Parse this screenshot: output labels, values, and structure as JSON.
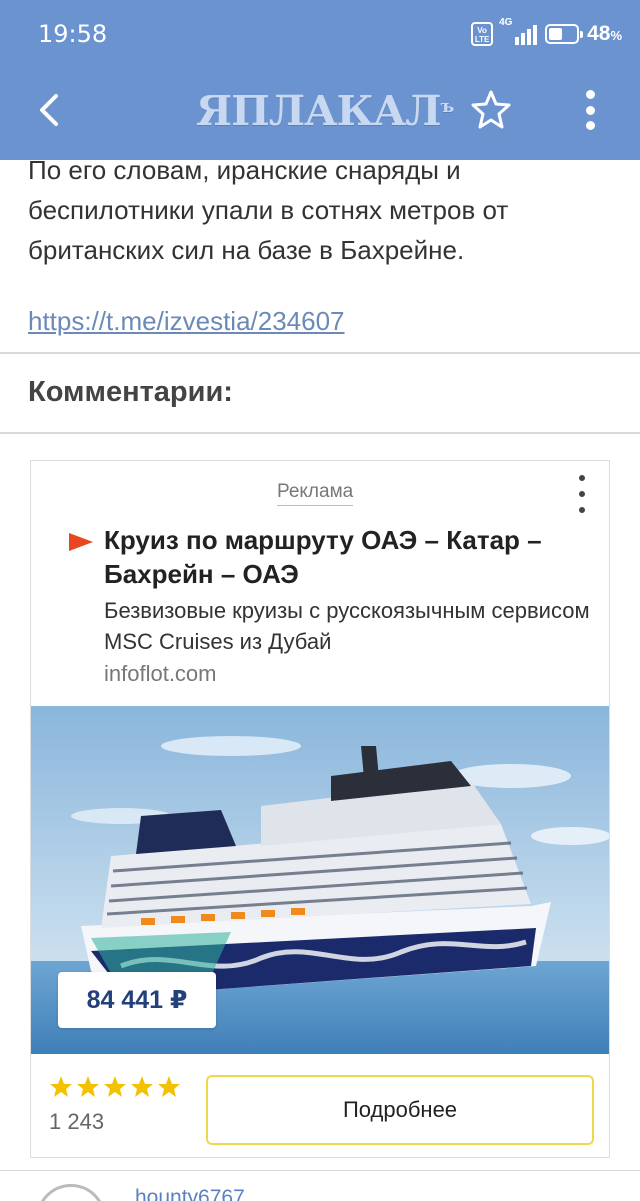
{
  "status_bar": {
    "time": "19:58",
    "volte": "Vo LTE",
    "network": "4G",
    "battery_percent": "48",
    "battery_unit": "%",
    "battery_level": 0.48
  },
  "app_bar": {
    "logo_text": "ЯПЛАКАЛ",
    "logo_suffix": "ъ",
    "back_icon": "chevron-left-icon",
    "favorite_icon": "star-outline-icon",
    "menu_icon": "vertical-dots-icon"
  },
  "article": {
    "text": "По его словам, иранские снаряды и беспилотники упали в сотнях метров от британских сил на базе в Бахрейне.",
    "link": "https://t.me/izvestia/234607"
  },
  "comments": {
    "title": "Комментарии:"
  },
  "ad": {
    "label": "Реклама",
    "title": "Круиз по маршруту ОАЭ – Катар – Бахрейн – ОАЭ",
    "description": "Безвизовые круизы с русскоязычным сервисом MSC Cruises из Дубай",
    "domain": "infoflot.com",
    "price": "84 441 ₽",
    "rating_stars": 5,
    "reviews_count": "1 243",
    "button_label": "Подробнее",
    "accent_color": "#f2c200",
    "play_icon_color": "#e8461f"
  },
  "next_comment": {
    "username": "hounty6767"
  }
}
